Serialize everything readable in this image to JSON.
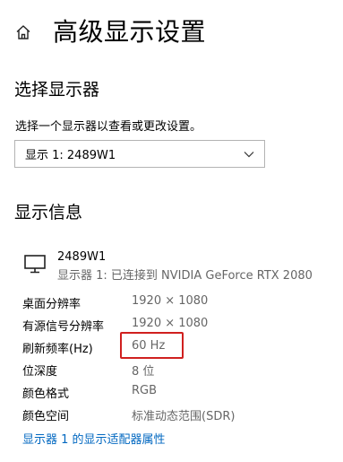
{
  "header": {
    "title": "高级显示设置"
  },
  "select_display": {
    "heading": "选择显示器",
    "description": "选择一个显示器以查看或更改设置。",
    "dropdown_value": "显示 1: 2489W1"
  },
  "display_info": {
    "heading": "显示信息",
    "monitor_name": "2489W1",
    "monitor_status": "显示器 1: 已连接到 NVIDIA GeForce RTX 2080",
    "rows": [
      {
        "label": "桌面分辨率",
        "value": "1920 × 1080"
      },
      {
        "label": "有源信号分辨率",
        "value": "1920 × 1080"
      },
      {
        "label": "刷新频率(Hz)",
        "value": "60 Hz"
      },
      {
        "label": "位深度",
        "value": "8 位"
      },
      {
        "label": "颜色格式",
        "value": "RGB"
      },
      {
        "label": "颜色空间",
        "value": "标准动态范围(SDR)"
      }
    ],
    "adapter_link": "显示器 1 的显示适配器属性"
  },
  "colors": {
    "link": "#0067c0",
    "highlight": "#d0201f",
    "secondary_text": "#666666"
  },
  "icons": [
    "home-icon",
    "chevron-down-icon",
    "monitor-icon"
  ]
}
